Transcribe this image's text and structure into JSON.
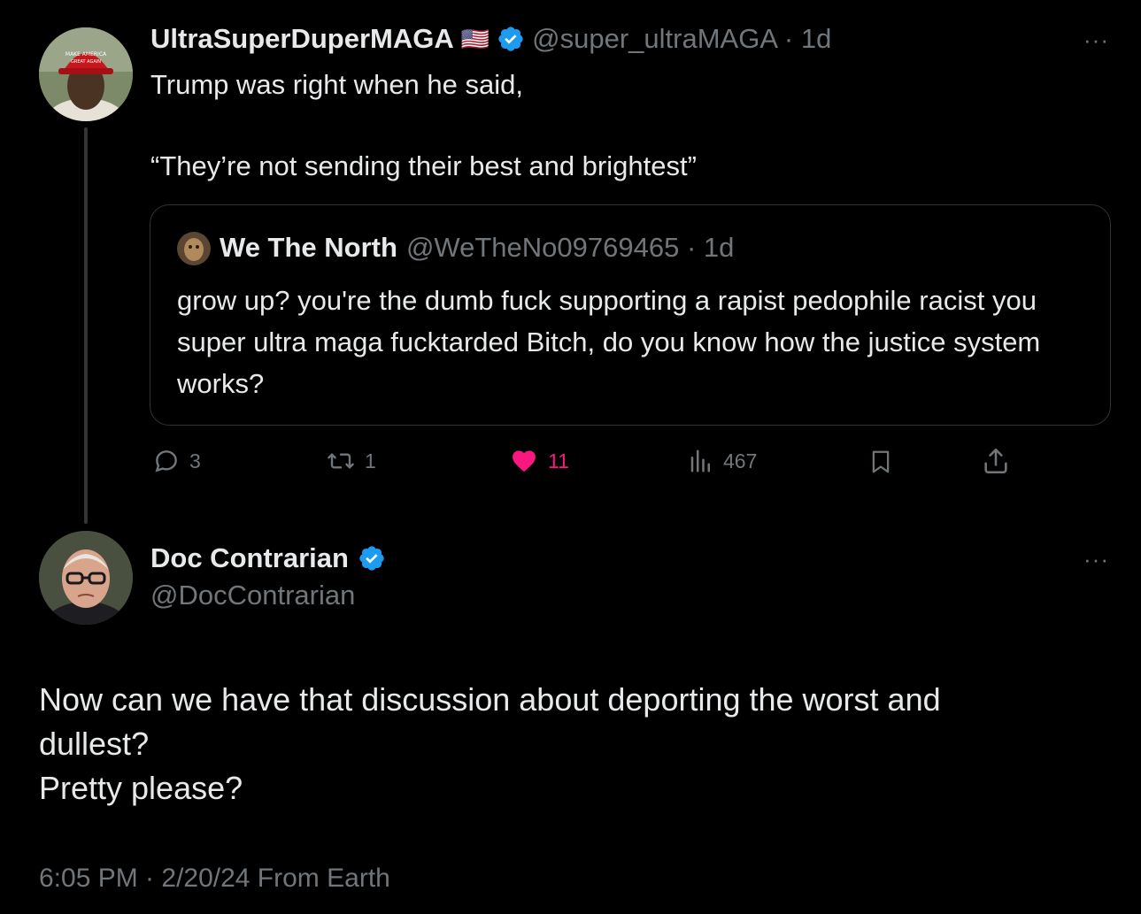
{
  "parent_tweet": {
    "display_name": "UltraSuperDuperMAGA",
    "flag_emoji": "🇺🇸",
    "handle": "@super_ultraMAGA",
    "separator": "·",
    "time": "1d",
    "more": "···",
    "text_line1": "Trump was right when he said,",
    "text_line2": "“They’re not sending their best and brightest”",
    "quote": {
      "display_name": "We The North",
      "handle": "@WeTheNo09769465",
      "separator": "·",
      "time": "1d",
      "text": "grow up? you're the dumb fuck supporting a rapist pedophile racist you super ultra maga fucktarded Bitch, do you know how the justice system works?"
    },
    "actions": {
      "replies": "3",
      "reposts": "1",
      "likes": "11",
      "views": "467"
    }
  },
  "main_tweet": {
    "display_name": "Doc Contrarian",
    "handle": "@DocContrarian",
    "more": "···",
    "text_line1": "Now can we have that discussion about deporting the worst and",
    "text_line2": "dullest?",
    "text_line3": "Pretty please?",
    "footer": "6:05 PM · 2/20/24 From Earth"
  },
  "colors": {
    "background": "#000000",
    "text": "#e7e9ea",
    "muted": "#71767b",
    "verified": "#1d9bf0",
    "like": "#f91880",
    "border": "#2f3336"
  }
}
